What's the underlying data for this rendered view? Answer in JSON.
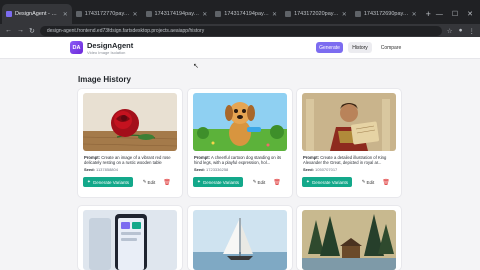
{
  "browser": {
    "tabs": [
      {
        "label": "DesignAgent - Frontend",
        "active": true
      },
      {
        "label": "1743172770pay.jpg (..."
      },
      {
        "label": "1743174194pay.jpg (..."
      },
      {
        "label": "1743174194pay.jpg (..."
      },
      {
        "label": "1743172020pay.jpg (..."
      },
      {
        "label": "1743172690pay.jpg (..."
      }
    ],
    "new_tab": "+",
    "address": "design-agent.frontend.ed73fdsign.fartsdesktop.projects.aeaiapp/history",
    "controls": {
      "min": "—",
      "max": "☐",
      "close": "✕"
    }
  },
  "header": {
    "logo_text": "DA",
    "title": "DesignAgent",
    "subtitle": "Video Image Isolation",
    "nav": {
      "generate": "Generate",
      "history": "History",
      "compare": "Compare"
    }
  },
  "page": {
    "title": "Image History"
  },
  "cards": [
    {
      "prompt_label": "Prompt:",
      "prompt": "Create an image of a vibrant red rose delicately resting on a rustic wooden table",
      "seed_label": "Seed:",
      "seed": "1137858804",
      "variants_label": "Generate Variants",
      "edit_label": "Edit"
    },
    {
      "prompt_label": "Prompt:",
      "prompt": "A cheerful cartoon dog standing on its hind legs, with a playful expression, hol...",
      "seed_label": "Seed:",
      "seed": "1723336258",
      "variants_label": "Generate Variants",
      "edit_label": "Edit"
    },
    {
      "prompt_label": "Prompt:",
      "prompt": "Create a detailed illustration of King Alexander the Great, depicted in royal ar...",
      "seed_label": "Seed:",
      "seed": "1050707017",
      "variants_label": "Generate Variants",
      "edit_label": "Edit"
    }
  ],
  "colors": {
    "accent": "#7c6cf0",
    "variants": "#13a88a",
    "delete": "#dc2626"
  }
}
